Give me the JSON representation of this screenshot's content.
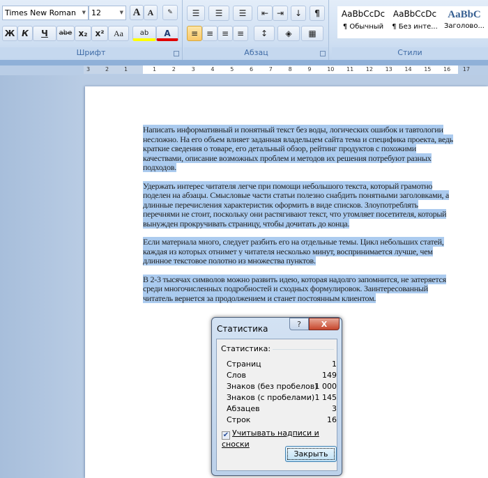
{
  "ribbon": {
    "font_group": {
      "label": "Шрифт",
      "font_name": "Times New Roman",
      "font_size": "12",
      "buttons": [
        "A",
        "A",
        "Ж",
        "К",
        "Ч",
        "abe",
        "x₂",
        "x²",
        "Aa",
        "ab",
        "A"
      ]
    },
    "paragraph_group": {
      "label": "Абзац",
      "pilcrow": "¶"
    },
    "styles_group": {
      "label": "Стили",
      "styles": [
        {
          "sample": "AaBbCcDc",
          "name": "¶ Обычный"
        },
        {
          "sample": "AaBbCcDc",
          "name": "¶ Без инте..."
        },
        {
          "sample": "AaBbC",
          "name": "Заголово..."
        }
      ]
    }
  },
  "ruler": {
    "ticks": [
      "3",
      "2",
      "1",
      "1",
      "2",
      "3",
      "4",
      "5",
      "6",
      "7",
      "8",
      "9",
      "10",
      "11",
      "12",
      "13",
      "14",
      "15",
      "16",
      "17"
    ]
  },
  "document": {
    "paragraphs": [
      [
        "Написать информативный и понятный текст  без воды, логических ошибок и тавтологии",
        "несложно. На его объем влияет заданная владельцем сайта тема и специфика проекта, ведь",
        "краткие сведения о товаре, его детальный обзор, рейтинг  продуктов с похожими",
        "качествами, описание  возможных проблем и методов их решения потребуют разных",
        "подходов."
      ],
      [
        "Удержать интерес читателя легче при помощи небольшого текста, который грамотно",
        "поделен на абзацы. Смысловые части статьи полезно снабдить понятными заголовками, а",
        "длинные перечисления  характеристик оформить в виде списков. Злоупотреблять",
        "перечнями не стоит, поскольку они растягивают текст, что утомляет посетителя, который",
        "вынужден прокручивать страницу, чтобы дочитать до конца."
      ],
      [
        "Если материала много, следует разбить его на  отдельные темы. Цикл небольших статей,",
        "каждая из которых отнимет у читателя несколько минут, воспринимается лучше, чем",
        "длинное текстовое полотно из множества пунктов."
      ],
      [
        "В 2-3 тысячах символов можно развить идею, которая надолго запомнится, не затеряется",
        "среди многочисленных подробностей и сходных формулировок. Заинтересованный",
        "читатель вернется за продолжением и станет  постоянным клиентом."
      ]
    ]
  },
  "dialog": {
    "title": "Статистика",
    "help": "?",
    "close": "X",
    "section": "Статистика:",
    "stats": [
      {
        "label": "Страниц",
        "value": "1"
      },
      {
        "label": "Слов",
        "value": "149"
      },
      {
        "label": "Знаков (без пробелов)",
        "value": "1 000"
      },
      {
        "label": "Знаков (с пробелами)",
        "value": "1 145"
      },
      {
        "label": "Абзацев",
        "value": "3"
      },
      {
        "label": "Строк",
        "value": "16"
      }
    ],
    "checkbox_label": "Учитывать надписи и сноски",
    "checkbox_checked": true,
    "close_button": "Закрыть"
  },
  "colors": {
    "selection": "#abcbef",
    "highlight": "#ffff00",
    "font_color": "#e00000"
  }
}
